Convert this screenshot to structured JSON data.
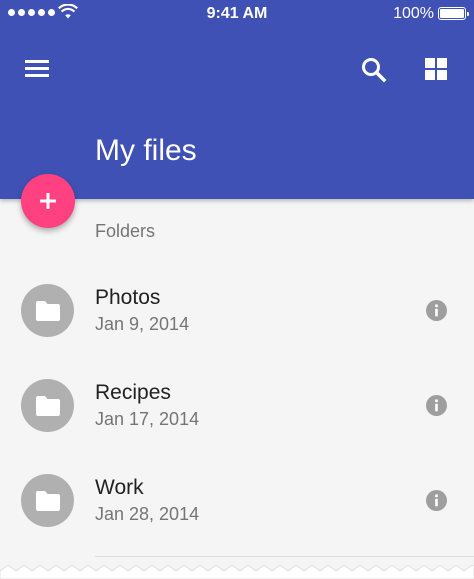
{
  "status_bar": {
    "time": "9:41 AM",
    "battery": "100%"
  },
  "toolbar": {
    "title": "My files",
    "icons": [
      "menu-icon",
      "search-icon",
      "grid-view-icon"
    ]
  },
  "fab": {
    "icon": "plus-icon",
    "color": "#ff4081"
  },
  "colors": {
    "primary": "#3f51b5",
    "accent": "#ff4081",
    "avatar": "#b0b0b0"
  },
  "folders": {
    "label": "Folders",
    "items": [
      {
        "name": "Photos",
        "date": "Jan 9, 2014"
      },
      {
        "name": "Recipes",
        "date": "Jan 17, 2014"
      },
      {
        "name": "Work",
        "date": "Jan 28, 2014"
      }
    ]
  }
}
